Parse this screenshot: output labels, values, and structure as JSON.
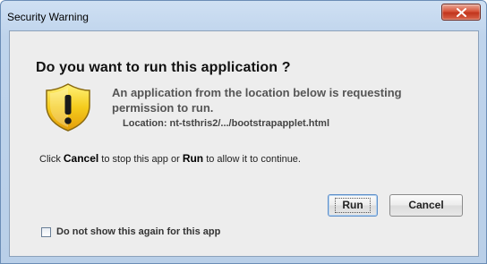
{
  "window": {
    "title": "Security Warning"
  },
  "dialog": {
    "heading": "Do you want to run this application ?",
    "message": "An application from the location below is requesting permission to run.",
    "location": "Location:  nt-tsthris2/.../bootstrapapplet.html",
    "instruction": {
      "part1": "Click ",
      "cancel_word": "Cancel",
      "part2": " to stop this app or ",
      "run_word": "Run",
      "part3": " to allow it to continue."
    }
  },
  "buttons": {
    "run_label": "Run",
    "cancel_label": "Cancel"
  },
  "checkbox": {
    "label": "Do not show this again for this app",
    "checked": false
  },
  "icons": {
    "warning": "warning-shield-icon",
    "close": "close-icon"
  },
  "colors": {
    "titlebar": "#c6daf0",
    "dialog_bg": "#ededed",
    "close_button": "#c9472f",
    "shield_yellow": "#f2c21a"
  }
}
